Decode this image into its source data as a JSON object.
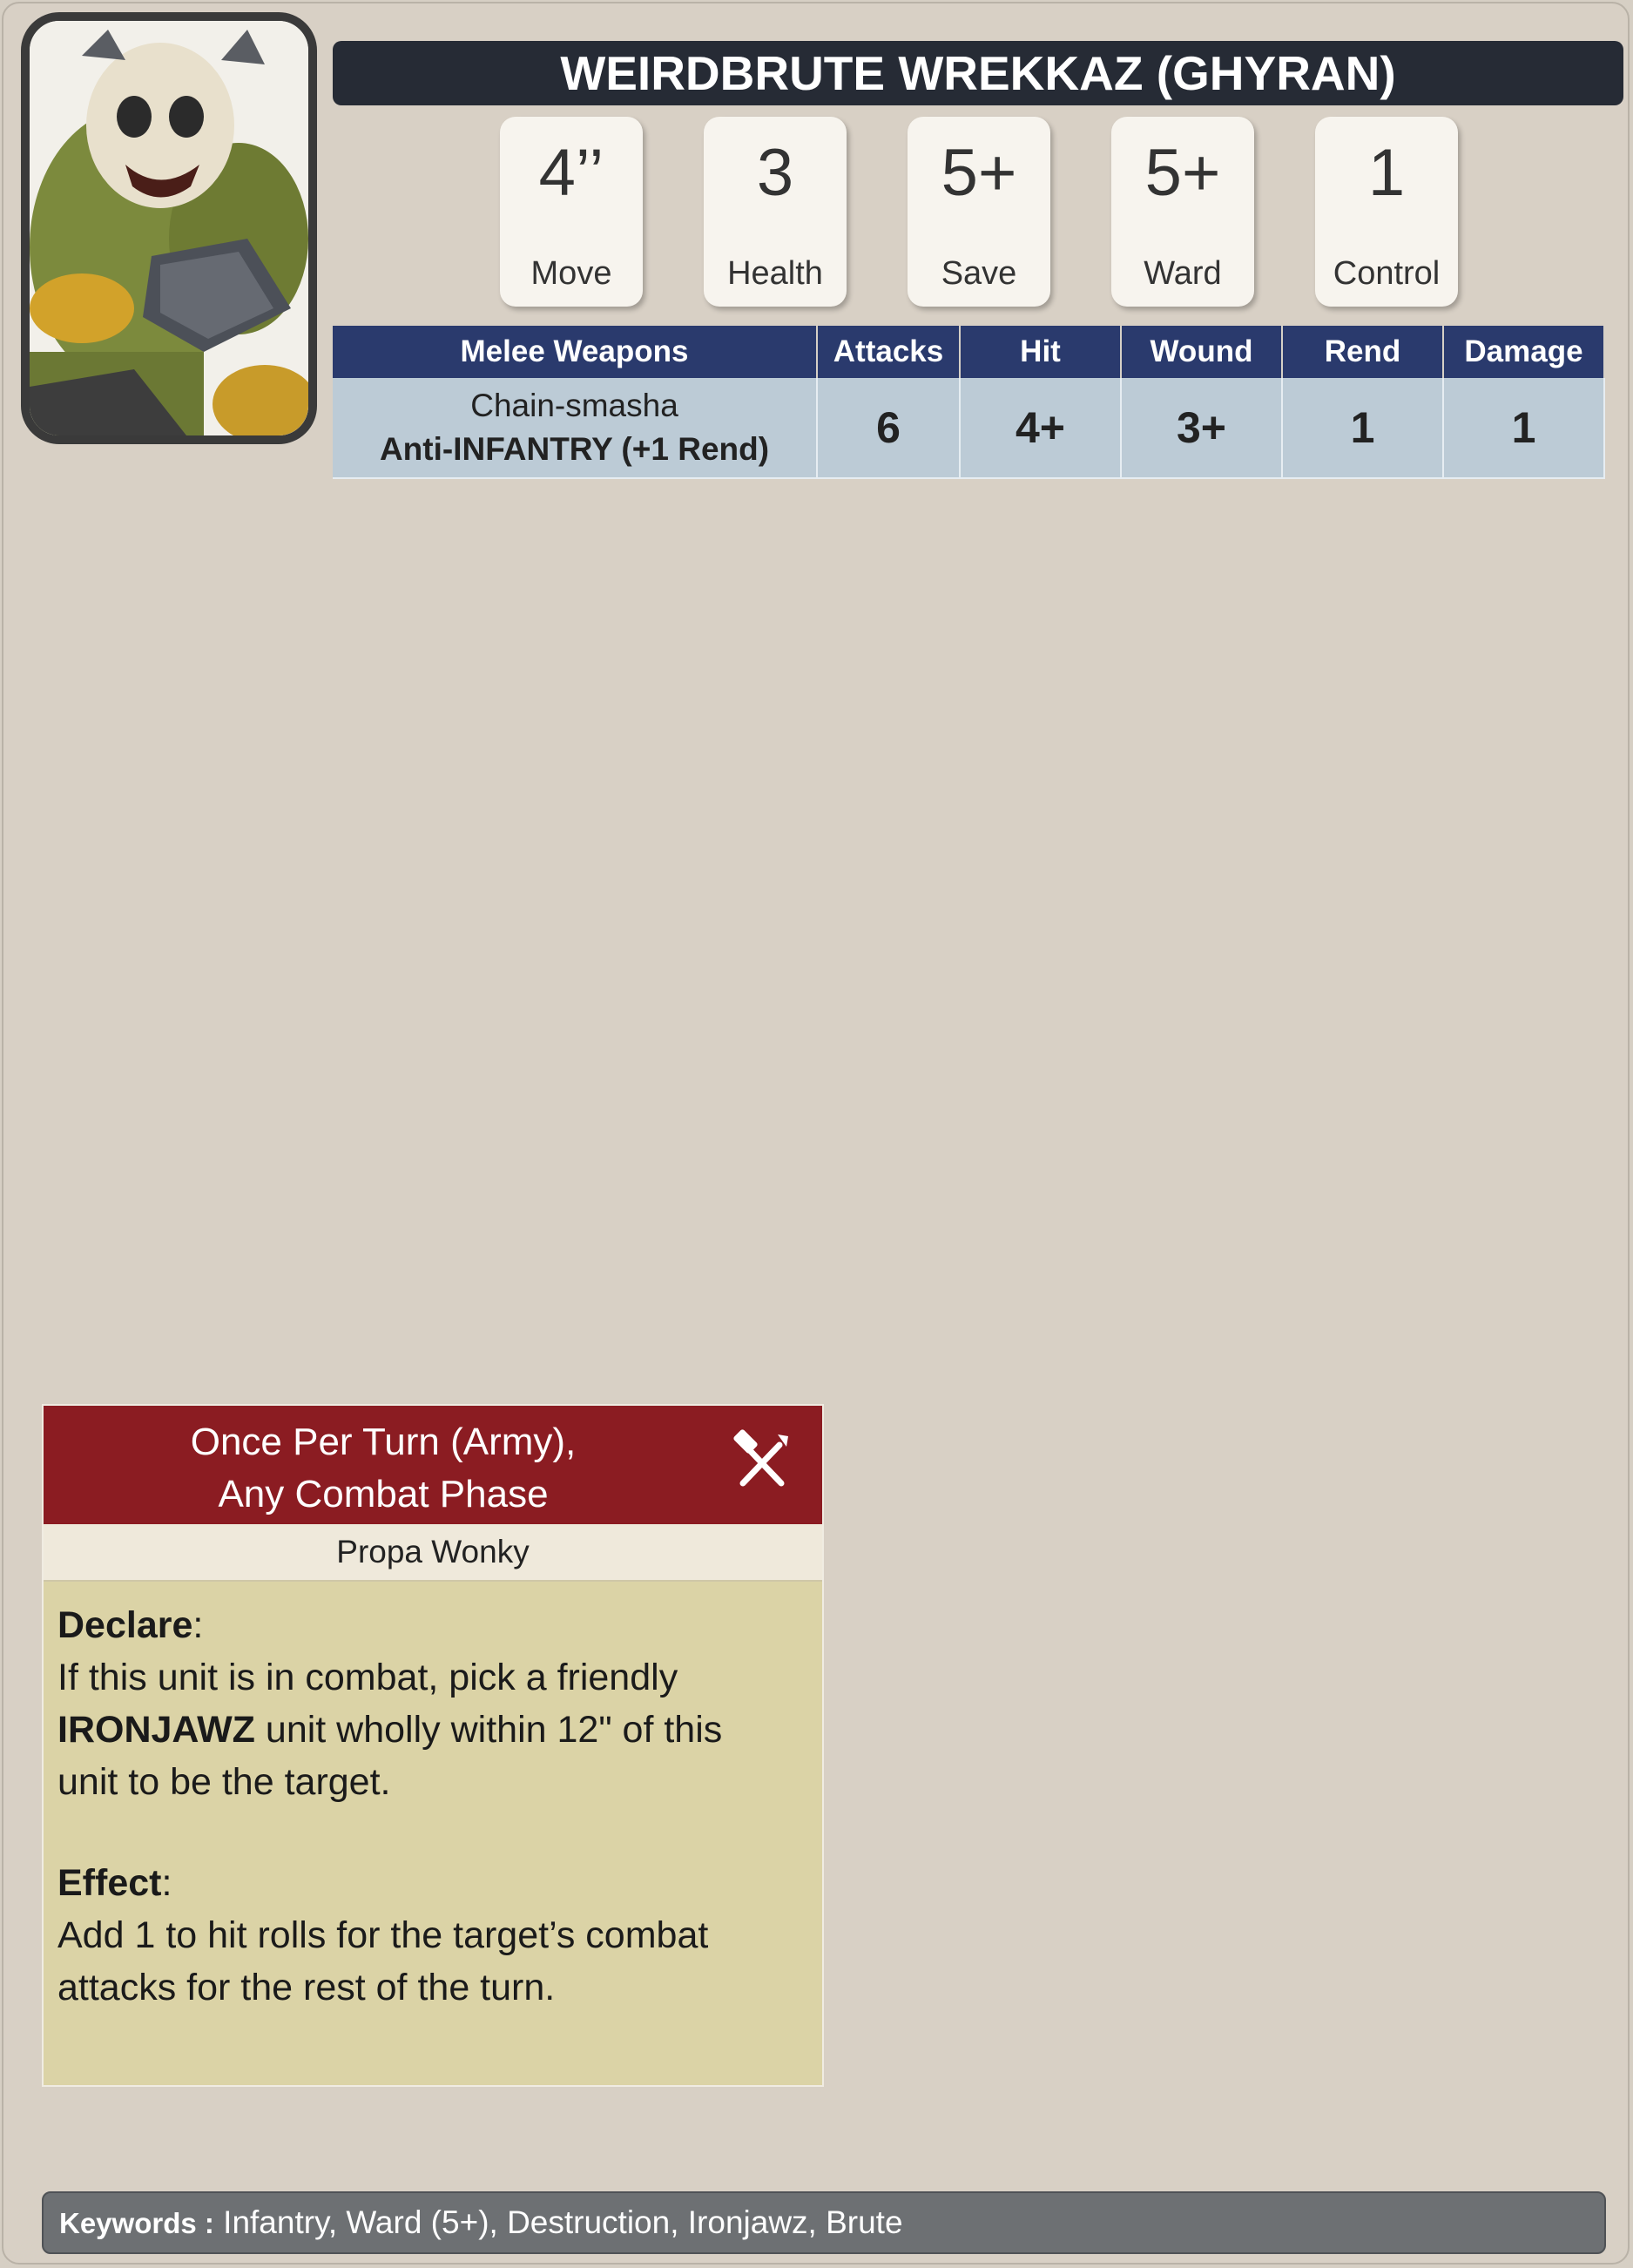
{
  "unit": {
    "name": "WEIRDBRUTE WREKKAZ (GHYRAN)"
  },
  "portrait": {
    "subject": "ork-brute-miniature"
  },
  "stats": [
    {
      "value": "4’’",
      "label": "Move"
    },
    {
      "value": "3",
      "label": "Health"
    },
    {
      "value": "5+",
      "label": "Save"
    },
    {
      "value": "5+",
      "label": "Ward"
    },
    {
      "value": "1",
      "label": "Control"
    }
  ],
  "weapons": {
    "headers": [
      "Melee Weapons",
      "Attacks",
      "Hit",
      "Wound",
      "Rend",
      "Damage"
    ],
    "rows": [
      {
        "name": "Chain-smasha",
        "ability": "Anti-INFANTRY (+1 Rend)",
        "attacks": "6",
        "hit": "4+",
        "wound": "3+",
        "rend": "1",
        "damage": "1"
      }
    ]
  },
  "ability": {
    "timing_line1": "Once Per Turn (Army),",
    "timing_line2": "Any Combat Phase",
    "icon": "crossed-hammer-sword-icon",
    "name": "Propa Wonky",
    "declare_label": "Declare",
    "declare_text_1": "If this unit is in combat, pick a friendly",
    "declare_keyword": "IRONJAWZ",
    "declare_text_2": " unit wholly within 12\" of this",
    "declare_text_3": "unit to be the target.",
    "effect_label": "Effect",
    "effect_text_1": "Add 1 to hit rolls for the target’s combat",
    "effect_text_2": "attacks for the rest of the turn."
  },
  "keywords": {
    "label": "Keywords",
    "values": "Infantry, Ward (5+), Destruction, Ironjawz, Brute"
  },
  "colors": {
    "title_bar": "#262b35",
    "table_header": "#2a3a6d",
    "table_row": "#bccbd6",
    "ability_header": "#8b1c22",
    "ability_body": "#dbd3a6",
    "keyword_bar": "#6d7073"
  }
}
